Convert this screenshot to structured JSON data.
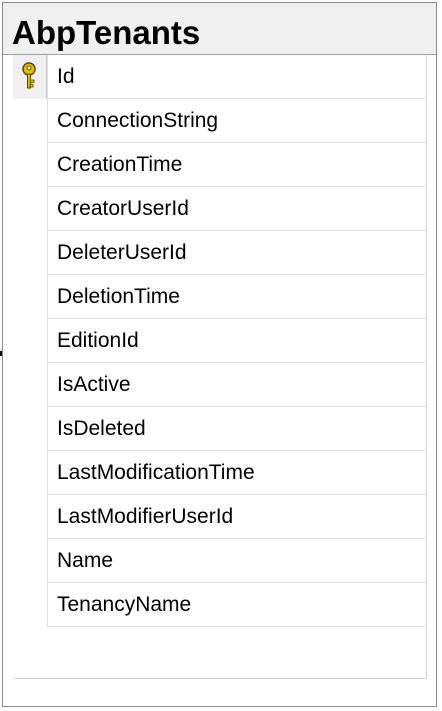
{
  "table": {
    "name": "AbpTenants"
  },
  "columns": [
    {
      "name": "Id",
      "primary_key": true,
      "icon": "key-icon"
    },
    {
      "name": "ConnectionString",
      "primary_key": false
    },
    {
      "name": "CreationTime",
      "primary_key": false
    },
    {
      "name": "CreatorUserId",
      "primary_key": false
    },
    {
      "name": "DeleterUserId",
      "primary_key": false
    },
    {
      "name": "DeletionTime",
      "primary_key": false
    },
    {
      "name": "EditionId",
      "primary_key": false
    },
    {
      "name": "IsActive",
      "primary_key": false
    },
    {
      "name": "IsDeleted",
      "primary_key": false
    },
    {
      "name": "LastModificationTime",
      "primary_key": false
    },
    {
      "name": "LastModifierUserId",
      "primary_key": false
    },
    {
      "name": "Name",
      "primary_key": false
    },
    {
      "name": "TenancyName",
      "primary_key": false
    }
  ],
  "colors": {
    "key_icon": "#e8c000",
    "header_background": "#f0f0f0",
    "border": "#8a8a8a"
  }
}
